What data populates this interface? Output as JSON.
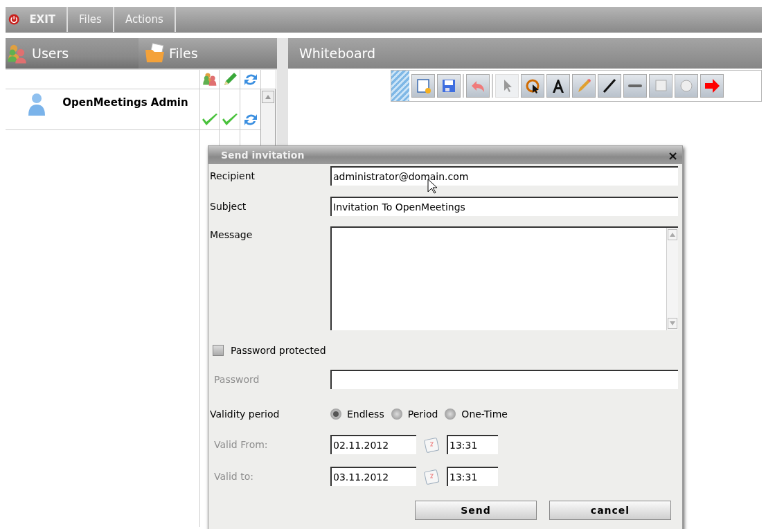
{
  "menu_bar": {
    "items": [
      {
        "kind": "exit",
        "label": "EXIT"
      },
      {
        "kind": "menu",
        "label": "Files"
      },
      {
        "kind": "menu",
        "label": "Actions"
      }
    ]
  },
  "side_tabs": [
    {
      "kind": "users",
      "label": "Users",
      "selected": true
    },
    {
      "kind": "files",
      "label": "Files",
      "selected": false
    }
  ],
  "users": [
    {
      "name": "OpenMeetings Admin",
      "moderator": true,
      "can_draw": true
    }
  ],
  "whiteboard": {
    "title": "Whiteboard",
    "tools": [
      {
        "kind": "new",
        "selected": false
      },
      {
        "kind": "save",
        "selected": false
      },
      {
        "kind": "sep"
      },
      {
        "kind": "undo",
        "selected": false
      },
      {
        "kind": "sep"
      },
      {
        "kind": "pointer",
        "selected": true
      },
      {
        "kind": "lasso",
        "selected": false
      },
      {
        "kind": "text",
        "selected": false
      },
      {
        "kind": "pencil",
        "selected": false
      },
      {
        "kind": "line",
        "selected": false
      },
      {
        "kind": "underline",
        "selected": false
      },
      {
        "kind": "rect",
        "selected": false
      },
      {
        "kind": "ellipse",
        "selected": false
      },
      {
        "kind": "arrow",
        "selected": false
      }
    ]
  },
  "dialog": {
    "title": "Send invitation",
    "close": "×",
    "recipient": {
      "label": "Recipient",
      "value": "administrator@domain.com"
    },
    "subject": {
      "label": "Subject",
      "value": "Invitation To OpenMeetings"
    },
    "message": {
      "label": "Message"
    },
    "password_protected": {
      "label": "Password protected",
      "checked": false
    },
    "password": {
      "label": "Password",
      "disabled": true
    },
    "validity": {
      "label": "Validity period",
      "options": [
        {
          "label": "Endless",
          "selected": true
        },
        {
          "label": "Period",
          "selected": false
        },
        {
          "label": "One-Time",
          "selected": false
        }
      ]
    },
    "valid_from": {
      "label": "Valid From:",
      "disabled": true,
      "date": "02.11.2012",
      "time": "13:31"
    },
    "valid_to": {
      "label": "Valid to:",
      "disabled": true,
      "date": "03.11.2012",
      "time": "13:31"
    },
    "buttons": [
      {
        "label": "Send"
      },
      {
        "label": "cancel"
      }
    ]
  }
}
